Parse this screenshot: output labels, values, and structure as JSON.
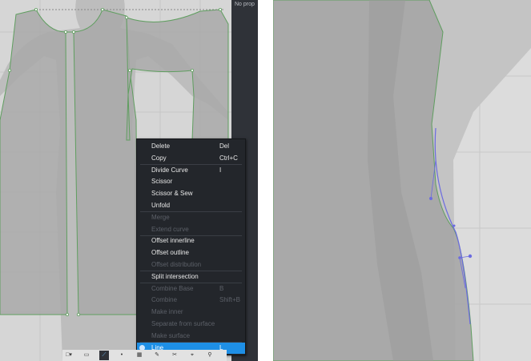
{
  "sidebar": {
    "header_text": "No prop"
  },
  "context_menu": {
    "items": [
      {
        "label": "Delete",
        "shortcut": "Del",
        "state": "normal"
      },
      {
        "label": "Copy",
        "shortcut": "Ctrl+C",
        "state": "normal"
      },
      {
        "label": "Divide Curve",
        "shortcut": "I",
        "state": "normal"
      },
      {
        "label": "Scissor",
        "shortcut": "",
        "state": "normal"
      },
      {
        "label": "Scissor & Sew",
        "shortcut": "",
        "state": "normal"
      },
      {
        "label": "Unfold",
        "shortcut": "",
        "state": "normal"
      },
      {
        "label": "Merge",
        "shortcut": "",
        "state": "disabled"
      },
      {
        "label": "Extend curve",
        "shortcut": "",
        "state": "disabled"
      },
      {
        "label": "Offset innerline",
        "shortcut": "",
        "state": "normal"
      },
      {
        "label": "Offset outline",
        "shortcut": "",
        "state": "normal"
      },
      {
        "label": "Offset distribution",
        "shortcut": "",
        "state": "disabled"
      },
      {
        "label": "Split intersection",
        "shortcut": "",
        "state": "normal"
      },
      {
        "label": "Combine Base",
        "shortcut": "B",
        "state": "disabled"
      },
      {
        "label": "Combine",
        "shortcut": "Shift+B",
        "state": "disabled"
      },
      {
        "label": "Make inner",
        "shortcut": "",
        "state": "disabled"
      },
      {
        "label": "Separate from surface",
        "shortcut": "",
        "state": "disabled"
      },
      {
        "label": "Make surface",
        "shortcut": "",
        "state": "disabled"
      },
      {
        "label": "Line",
        "shortcut": "L",
        "state": "selected"
      }
    ]
  },
  "toolbar": {
    "buttons": [
      {
        "icon": "select-points-icon",
        "glyph": "□▾",
        "active": false
      },
      {
        "icon": "rectangle-tool-icon",
        "glyph": "▭",
        "active": false
      },
      {
        "icon": "curve-tool-icon",
        "glyph": "⟋",
        "active": true
      },
      {
        "icon": "point-tool-icon",
        "glyph": "•",
        "active": false
      },
      {
        "icon": "grid-tool-icon",
        "glyph": "▦",
        "active": false
      },
      {
        "icon": "pen-tool-icon",
        "glyph": "✎",
        "active": false
      },
      {
        "icon": "cut-tool-icon",
        "glyph": "✂",
        "active": false
      },
      {
        "icon": "measure-tool-icon",
        "glyph": "⌖",
        "active": false
      },
      {
        "icon": "zoom-icon",
        "glyph": "⚲",
        "active": false
      }
    ]
  },
  "colors": {
    "canvas_background": "#d6d6d6",
    "pattern_fill": "#a8a8a8",
    "avatar_silhouette": "#bdbdbd",
    "outline": "#5f9e5f",
    "menu_background": "#23262b",
    "menu_highlight": "#1e8fe6",
    "curve_edit": "#6b6be0"
  }
}
